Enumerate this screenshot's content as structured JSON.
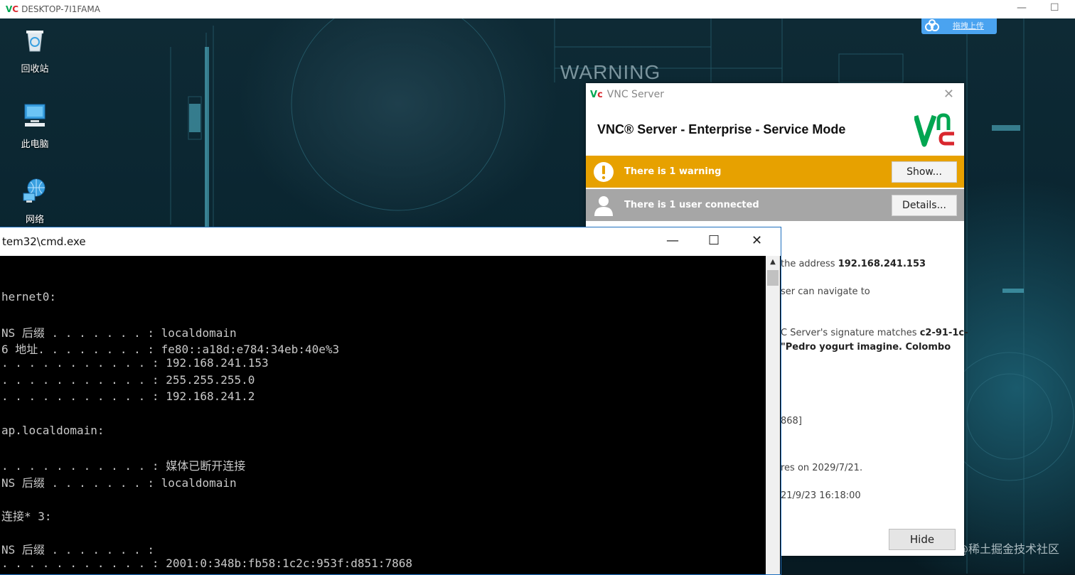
{
  "viewer": {
    "title": "DESKTOP-7I1FAMA",
    "logo_v": "V",
    "logo_c": "C",
    "minimize": "—",
    "maximize": "☐"
  },
  "desktop": {
    "icons": [
      {
        "label": "回收站",
        "icon": "recycle-bin-icon"
      },
      {
        "label": "此电脑",
        "icon": "computer-icon"
      },
      {
        "label": "网络",
        "icon": "network-icon"
      }
    ],
    "upload_label": "拖拽上传",
    "background_text": "WARNING",
    "watermark": "@稀土掘金技术社区"
  },
  "vnc_server": {
    "window_title": "VNC Server",
    "close": "✕",
    "heading": "VNC® Server - Enterprise - Service Mode",
    "warning_text": "There is 1 warning",
    "show_button": "Show...",
    "user_text": "There is 1 user connected",
    "details_button": "Details...",
    "lines": [
      {
        "prefix": "the address ",
        "bold": "192.168.241.153",
        "suffix": ""
      },
      {
        "prefix": "ser can navigate to",
        "bold": "",
        "suffix": ""
      },
      {
        "prefix": "C Server's signature matches ",
        "bold": "c2-91-1c-",
        "suffix": ""
      },
      {
        "prefix": "",
        "bold": "\"Pedro yogurt imagine. Colombo",
        "suffix": ""
      },
      {
        "prefix": "868]",
        "bold": "",
        "suffix": ""
      },
      {
        "prefix": "res on 2029/7/21.",
        "bold": "",
        "suffix": ""
      },
      {
        "prefix": "21/9/23 16:18:00",
        "bold": "",
        "suffix": ""
      }
    ],
    "hide_button": "Hide",
    "colors": {
      "warning": "#e7a100",
      "user_row": "#a6a6a6",
      "logo_green": "#00a651",
      "logo_red": "#d9272e"
    }
  },
  "cmd": {
    "title": "tem32\\cmd.exe",
    "minimize": "—",
    "maximize": "☐",
    "close": "✕",
    "lines": [
      "hernet0:",
      "",
      "NS 后缀 . . . . . . . : localdomain",
      "6 地址. . . . . . . . : fe80::a18d:e784:34eb:40e%3",
      ". . . . . . . . . . . : 192.168.241.153",
      ". . . . . . . . . . . : 255.255.255.0",
      ". . . . . . . . . . . : 192.168.241.2",
      "",
      "ap.localdomain:",
      "",
      ". . . . . . . . . . . : 媒体已断开连接",
      "NS 后缀 . . . . . . . : localdomain",
      "",
      "连接* 3:",
      "",
      "NS 后缀 . . . . . . . :",
      ". . . . . . . . . . . : 2001:0:348b:fb58:1c2c:953f:d851:7868"
    ]
  }
}
